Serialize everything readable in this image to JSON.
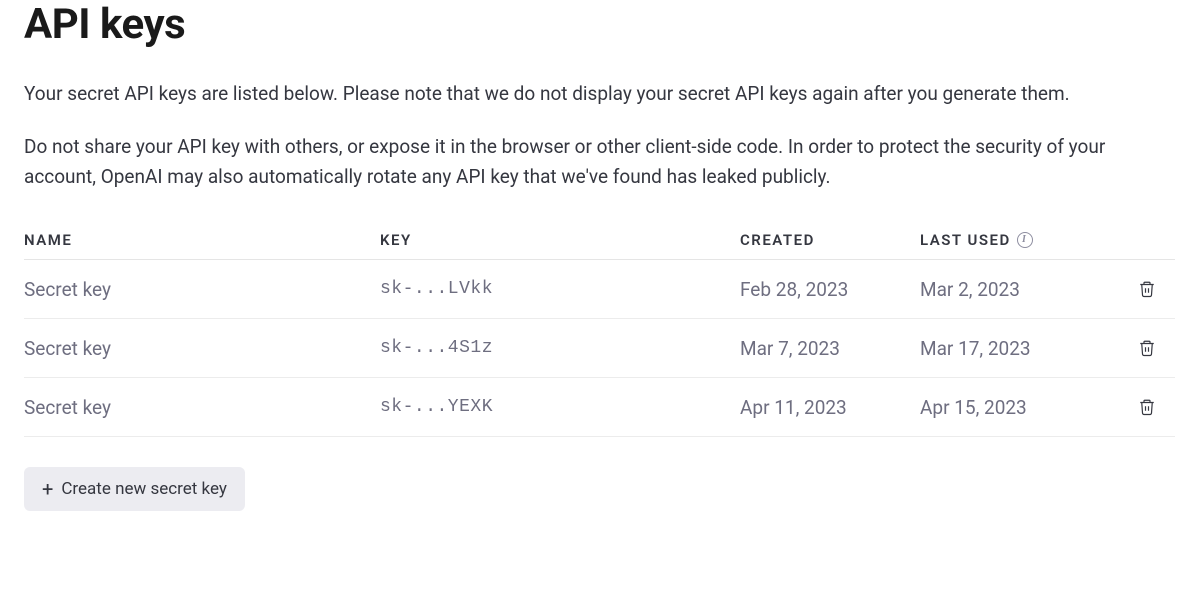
{
  "page": {
    "title": "API keys",
    "description1": "Your secret API keys are listed below. Please note that we do not display your secret API keys again after you generate them.",
    "description2": "Do not share your API key with others, or expose it in the browser or other client-side code. In order to protect the security of your account, OpenAI may also automatically rotate any API key that we've found has leaked publicly."
  },
  "table": {
    "headers": {
      "name": "NAME",
      "key": "KEY",
      "created": "CREATED",
      "lastused": "LAST USED"
    },
    "rows": [
      {
        "name": "Secret key",
        "key": "sk-...LVkk",
        "created": "Feb 28, 2023",
        "lastused": "Mar 2, 2023"
      },
      {
        "name": "Secret key",
        "key": "sk-...4S1z",
        "created": "Mar 7, 2023",
        "lastused": "Mar 17, 2023"
      },
      {
        "name": "Secret key",
        "key": "sk-...YEXK",
        "created": "Apr 11, 2023",
        "lastused": "Apr 15, 2023"
      }
    ]
  },
  "buttons": {
    "create": "Create new secret key"
  }
}
